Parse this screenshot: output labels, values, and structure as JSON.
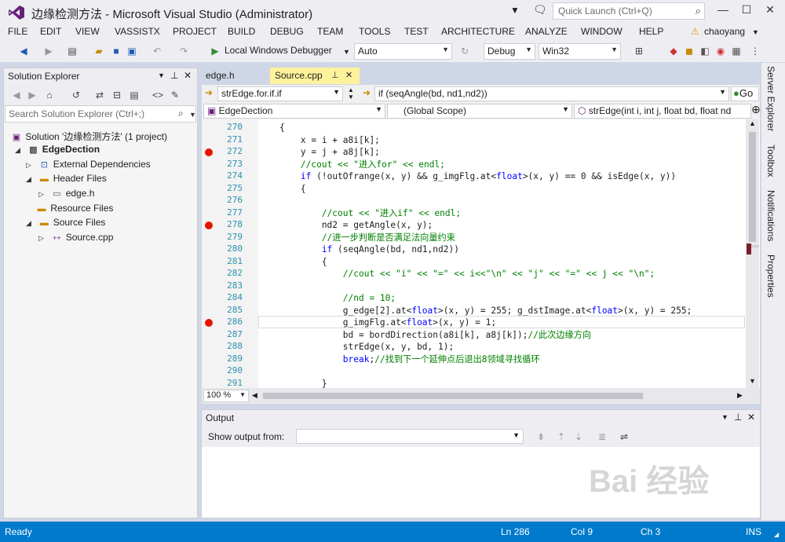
{
  "window": {
    "title": "边缘检测方法 - Microsoft Visual Studio (Administrator)",
    "quick_launch_placeholder": "Quick Launch (Ctrl+Q)",
    "user": "chaoyang"
  },
  "menu": [
    "FILE",
    "EDIT",
    "VIEW",
    "VASSISTX",
    "PROJECT",
    "BUILD",
    "DEBUG",
    "TEAM",
    "TOOLS",
    "TEST",
    "ARCHITECTURE",
    "ANALYZE",
    "WINDOW",
    "HELP"
  ],
  "toolbar": {
    "debugger_label": "Local Windows Debugger",
    "config_combo": "Auto",
    "build_config": "Debug",
    "platform": "Win32"
  },
  "solution_explorer": {
    "title": "Solution Explorer",
    "search_placeholder": "Search Solution Explorer (Ctrl+;)",
    "solution": "Solution '边缘检测方法' (1 project)",
    "project": "EdgeDection",
    "items": [
      {
        "label": "External Dependencies",
        "level": 2
      },
      {
        "label": "Header Files",
        "level": 2
      },
      {
        "label": "edge.h",
        "level": 3
      },
      {
        "label": "Resource Files",
        "level": 2
      },
      {
        "label": "Source Files",
        "level": 2
      },
      {
        "label": "Source.cpp",
        "level": 3
      }
    ]
  },
  "editor": {
    "tabs": [
      {
        "label": "edge.h",
        "active": false
      },
      {
        "label": "Source.cpp",
        "active": true
      }
    ],
    "nav_scope": "strEdge.for.if.if",
    "nav_member": "if (seqAngle(bd, nd1,nd2))",
    "go_label": "Go",
    "project_combo": "EdgeDection",
    "scope_combo": "(Global Scope)",
    "function_combo": "strEdge(int i, int j, float bd, float nd",
    "zoom": "100 %",
    "lines": [
      {
        "n": "270",
        "code": "    {",
        "bp": false
      },
      {
        "n": "271",
        "code": "        x = i + a8i[k];",
        "bp": false
      },
      {
        "n": "272",
        "code": "        y = j + a8j[k];",
        "bp": true
      },
      {
        "n": "273",
        "code": "        //cout << \"进入for\" << endl;",
        "bp": false,
        "comment": true
      },
      {
        "n": "274",
        "code": "        if (!outOfrange(x, y) && g_imgFlg.at<float>(x, y) == 0 && isEdge(x, y))",
        "bp": false
      },
      {
        "n": "275",
        "code": "        {",
        "bp": false
      },
      {
        "n": "276",
        "code": "",
        "bp": false
      },
      {
        "n": "277",
        "code": "            //cout << \"进入if\" << endl;",
        "bp": false,
        "comment": true
      },
      {
        "n": "278",
        "code": "            nd2 = getAngle(x, y);",
        "bp": true
      },
      {
        "n": "279",
        "code": "            //进一步判断是否满足法向量约束",
        "bp": false,
        "comment": true
      },
      {
        "n": "280",
        "code": "            if (seqAngle(bd, nd1,nd2))",
        "bp": false
      },
      {
        "n": "281",
        "code": "            {",
        "bp": false
      },
      {
        "n": "282",
        "code": "                //cout << \"i\" << \"=\" << i<<\"\\n\" << \"j\" << \"=\" << j << \"\\n\";",
        "bp": false,
        "comment": true
      },
      {
        "n": "283",
        "code": "",
        "bp": false
      },
      {
        "n": "284",
        "code": "                //nd = 10;",
        "bp": false,
        "comment": true
      },
      {
        "n": "285",
        "code": "                g_edge[2].at<float>(x, y) = 255; g_dstImage.at<float>(x, y) = 255;",
        "bp": false
      },
      {
        "n": "286",
        "code": "                g_imgFlg.at<float>(x, y) = 1;",
        "bp": true
      },
      {
        "n": "287",
        "code": "                bd = bordDirection(a8i[k], a8j[k]);//此次边缘方向",
        "bp": false
      },
      {
        "n": "288",
        "code": "                strEdge(x, y, bd, 1);",
        "bp": false
      },
      {
        "n": "289",
        "code": "                break;//找到下一个延伸点后退出8领域寻找循环",
        "bp": false
      },
      {
        "n": "290",
        "code": "",
        "bp": false
      },
      {
        "n": "291",
        "code": "            }",
        "bp": false
      }
    ]
  },
  "output": {
    "title": "Output",
    "show_from_label": "Show output from:",
    "show_from_value": ""
  },
  "right_tabs": [
    "Server Explorer",
    "Toolbox",
    "Notifications",
    "Properties"
  ],
  "status": {
    "ready": "Ready",
    "ln": "Ln 286",
    "col": "Col 9",
    "ch": "Ch 3",
    "ins": "INS"
  },
  "watermark": "Bai 经验"
}
